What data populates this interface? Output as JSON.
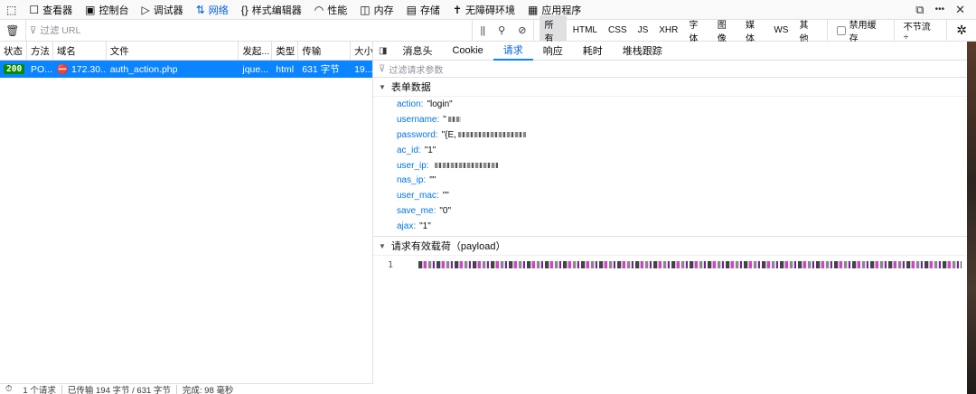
{
  "toolbox": {
    "items": [
      {
        "icon": "pick-icon",
        "glyph": "⬚",
        "label": ""
      },
      {
        "icon": "inspector-icon",
        "glyph": "☐",
        "label": "查看器"
      },
      {
        "icon": "console-icon",
        "glyph": "▣",
        "label": "控制台"
      },
      {
        "icon": "debugger-icon",
        "glyph": "▷",
        "label": "调试器"
      },
      {
        "icon": "network-icon",
        "glyph": "⇅",
        "label": "网络"
      },
      {
        "icon": "style-editor-icon",
        "glyph": "{}",
        "label": "样式编辑器"
      },
      {
        "icon": "performance-icon",
        "glyph": "◠",
        "label": "性能"
      },
      {
        "icon": "memory-icon",
        "glyph": "◫",
        "label": "内存"
      },
      {
        "icon": "storage-icon",
        "glyph": "▤",
        "label": "存储"
      },
      {
        "icon": "accessibility-icon",
        "glyph": "✝",
        "label": "无障碍环境"
      },
      {
        "icon": "application-icon",
        "glyph": "▦",
        "label": "应用程序"
      }
    ],
    "active": "网络",
    "right_icons": {
      "dock": "⧉",
      "more": "•••",
      "close": "✕"
    }
  },
  "filterbar": {
    "placeholder": "过滤 URL",
    "pause": "||",
    "search": "⚲",
    "block": "⊘",
    "type_filters": [
      "所有",
      "HTML",
      "CSS",
      "JS",
      "XHR",
      "字体",
      "图像",
      "媒体",
      "WS",
      "其他"
    ],
    "active_type": "所有",
    "disable_cache": "禁用缓存",
    "throttle": "不节流 ÷",
    "settings": "✲"
  },
  "table": {
    "headers": [
      "状态",
      "方法",
      "域名",
      "文件",
      "发起...",
      "类型",
      "传输",
      "大小"
    ],
    "rows": [
      {
        "status": "200",
        "method": "PO...",
        "domain": "172.30....",
        "file": "auth_action.php",
        "initiator": "jque...",
        "type": "html",
        "transferred": "631 字节",
        "size": "19..."
      }
    ]
  },
  "statusbar": {
    "requests": "1 个请求",
    "transferred": "已传输 194 字节 / 631 字节",
    "finish": "完成: 98 毫秒"
  },
  "details": {
    "tabs": [
      "消息头",
      "Cookie",
      "请求",
      "响应",
      "耗时",
      "堆栈跟踪"
    ],
    "active_tab": "请求",
    "param_filter_placeholder": "过滤请求参数",
    "form_section_title": "表单数据",
    "form_fields": [
      {
        "key": "action:",
        "value": "\"login\"",
        "redacted": false
      },
      {
        "key": "username:",
        "value": "\"",
        "redacted": true
      },
      {
        "key": "password:",
        "value": "\"{E,",
        "redacted": true
      },
      {
        "key": "ac_id:",
        "value": "\"1\"",
        "redacted": false
      },
      {
        "key": "user_ip:",
        "value": "",
        "redacted": true
      },
      {
        "key": "nas_ip:",
        "value": "\"\"",
        "redacted": false
      },
      {
        "key": "user_mac:",
        "value": "\"\"",
        "redacted": false
      },
      {
        "key": "save_me:",
        "value": "\"0\"",
        "redacted": false
      },
      {
        "key": "ajax:",
        "value": "\"1\"",
        "redacted": false
      }
    ],
    "payload_section_title": "请求有效载荷（payload）",
    "payload_line_number": "1"
  },
  "colors": {
    "accent": "#0a84ff",
    "active_text": "#0060df",
    "status_ok": "#058b00",
    "field_key": "#0074e8"
  }
}
